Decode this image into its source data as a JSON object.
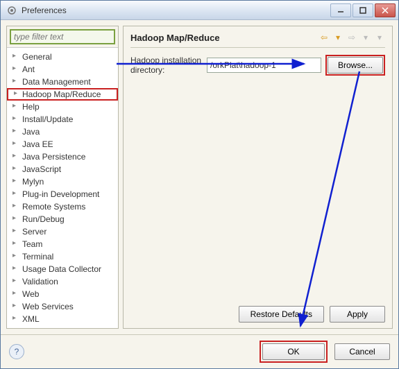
{
  "window": {
    "title": "Preferences"
  },
  "filter": {
    "placeholder": "type filter text"
  },
  "tree": {
    "items": [
      "General",
      "Ant",
      "Data Management",
      "Hadoop Map/Reduce",
      "Help",
      "Install/Update",
      "Java",
      "Java EE",
      "Java Persistence",
      "JavaScript",
      "Mylyn",
      "Plug-in Development",
      "Remote Systems",
      "Run/Debug",
      "Server",
      "Team",
      "Terminal",
      "Usage Data Collector",
      "Validation",
      "Web",
      "Web Services",
      "XML"
    ],
    "selected_index": 3
  },
  "page": {
    "title": "Hadoop Map/Reduce",
    "dir_label": "Hadoop installation directory:",
    "dir_value": "/orkPlat\\hadoop-1",
    "browse": "Browse...",
    "restore": "Restore Defaults",
    "apply": "Apply"
  },
  "bottom": {
    "ok": "OK",
    "cancel": "Cancel"
  }
}
